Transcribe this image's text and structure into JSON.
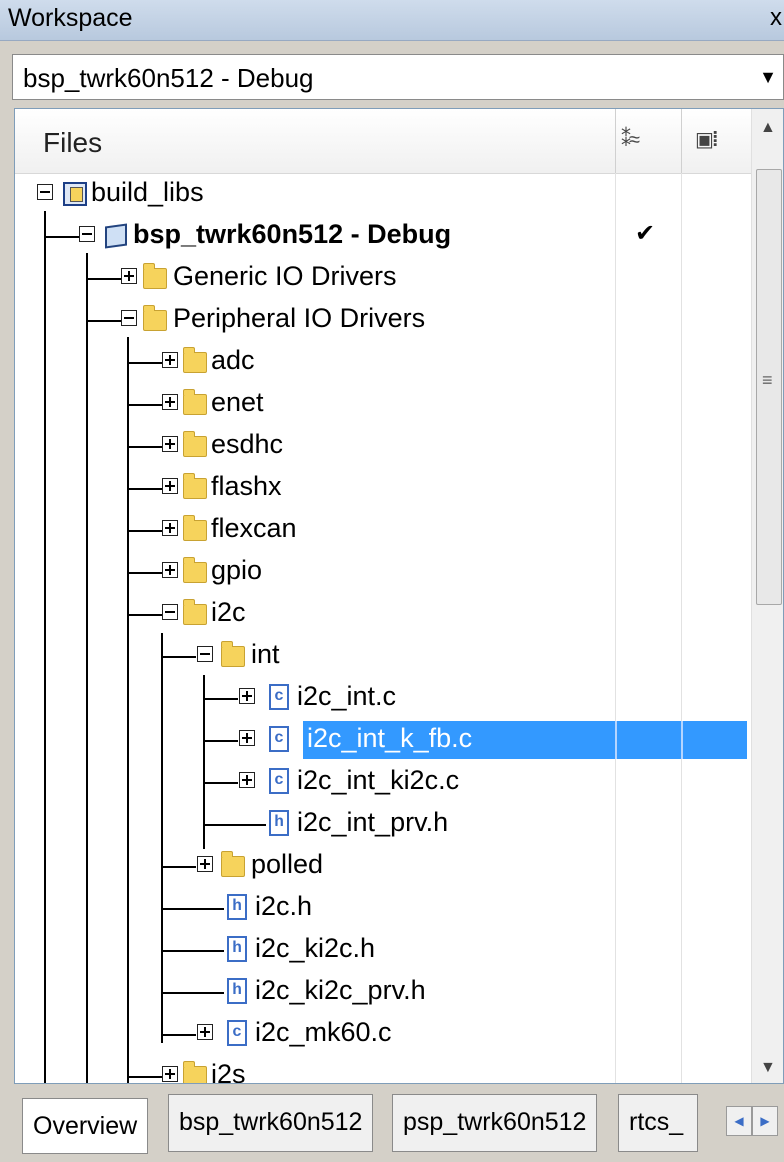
{
  "window": {
    "title": "Workspace",
    "close_glyph": "x"
  },
  "config_select": {
    "value": "bsp_twrk60n512 - Debug"
  },
  "files_header": {
    "label": "Files",
    "col1_icon": "sort-icon",
    "col2_icon": "output-icon"
  },
  "tree": [
    {
      "label": "build_libs"
    },
    {
      "label": "bsp_twrk60n512 - Debug",
      "check": "✔"
    },
    {
      "label": "Generic IO Drivers"
    },
    {
      "label": "Peripheral IO Drivers"
    },
    {
      "label": "adc"
    },
    {
      "label": "enet"
    },
    {
      "label": "esdhc"
    },
    {
      "label": "flashx"
    },
    {
      "label": "flexcan"
    },
    {
      "label": "gpio"
    },
    {
      "label": "i2c"
    },
    {
      "label": "int"
    },
    {
      "label": "i2c_int.c"
    },
    {
      "label": "i2c_int_k_fb.c"
    },
    {
      "label": "i2c_int_ki2c.c"
    },
    {
      "label": "i2c_int_prv.h"
    },
    {
      "label": "polled"
    },
    {
      "label": "i2c.h"
    },
    {
      "label": "i2c_ki2c.h"
    },
    {
      "label": "i2c_ki2c_prv.h"
    },
    {
      "label": "i2c_mk60.c"
    },
    {
      "label": "i2s"
    }
  ],
  "tabs": [
    {
      "label": "Overview"
    },
    {
      "label": "bsp_twrk60n512"
    },
    {
      "label": "psp_twrk60n512"
    },
    {
      "label": "rtcs_"
    }
  ],
  "tab_nav": {
    "prev": "◀",
    "next": "▶"
  }
}
